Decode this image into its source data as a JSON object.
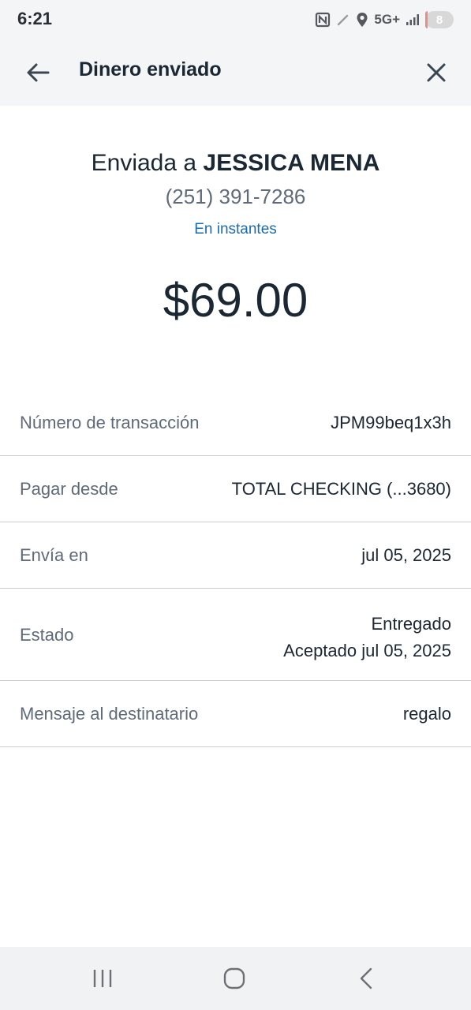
{
  "status_bar": {
    "time": "6:21",
    "network": "5G+",
    "battery_level": "8",
    "icons": [
      "nfc-icon",
      "pen-icon",
      "location-icon",
      "signal-icon",
      "battery-icon"
    ]
  },
  "header": {
    "title": "Dinero enviado",
    "back_icon": "back-arrow-icon",
    "close_icon": "close-icon"
  },
  "summary": {
    "sent_prefix": "Enviada a ",
    "recipient_name": "JESSICA MENA",
    "recipient_phone": "(251) 391-7286",
    "delivery_speed": "En instantes",
    "amount": "$69.00"
  },
  "details": {
    "transaction_label": "Número de transacción",
    "transaction_value": "JPM99beq1x3h",
    "pay_from_label": "Pagar desde",
    "pay_from_value": "TOTAL CHECKING (...3680)",
    "send_on_label": "Envía en",
    "send_on_value": "jul 05, 2025",
    "status_label": "Estado",
    "status_value": "Entregado",
    "status_detail": "Aceptado jul 05, 2025",
    "message_label": "Mensaje al destinatario",
    "message_value": "regalo"
  },
  "nav_bar": {
    "icons": [
      "recent-apps-icon",
      "home-icon",
      "back-icon"
    ]
  },
  "colors": {
    "header_bg": "#f4f5f7",
    "text_primary": "#1b2733",
    "text_secondary": "#5f6b78",
    "link_blue": "#1a6bb0",
    "divider": "#c9cdd1",
    "battery_low": "#f08a86"
  }
}
